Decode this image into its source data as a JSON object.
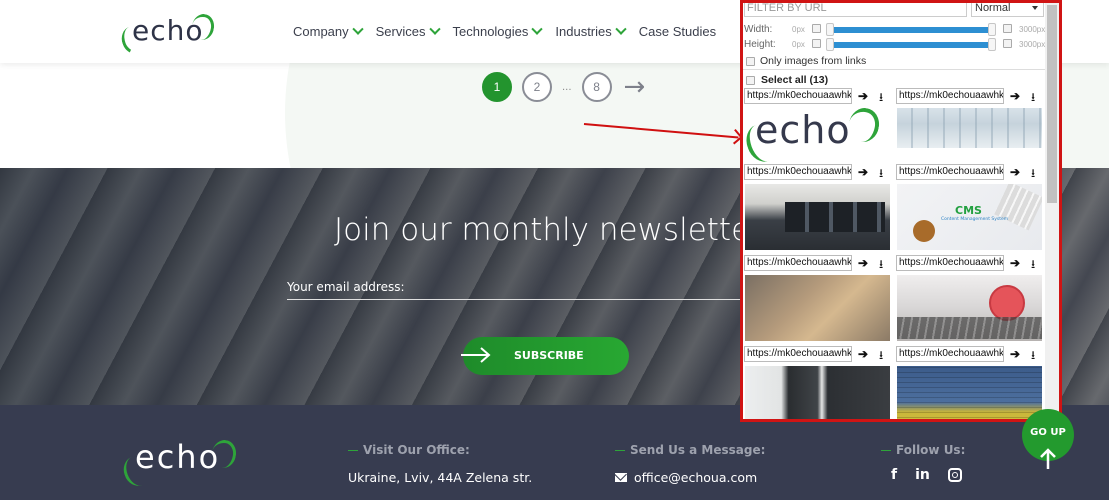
{
  "header": {
    "logo_text": "echo",
    "nav": [
      {
        "label": "Company",
        "has_dropdown": true
      },
      {
        "label": "Services",
        "has_dropdown": true
      },
      {
        "label": "Technologies",
        "has_dropdown": true
      },
      {
        "label": "Industries",
        "has_dropdown": true
      },
      {
        "label": "Case Studies",
        "has_dropdown": false
      }
    ]
  },
  "pagination": {
    "pages": [
      "1",
      "2",
      "8"
    ],
    "current": "1",
    "ellipsis": "...",
    "next_icon": "arrow-right-icon"
  },
  "newsletter": {
    "title": "Join our monthly newsletter",
    "email_placeholder": "Your email address:",
    "subscribe_label": "SUBSCRIBE"
  },
  "footer": {
    "logo_text": "echo",
    "office_heading": "Visit Our Office:",
    "office_address": "Ukraine, Lviv, 44A Zelena str.",
    "message_heading": "Send Us a Message:",
    "email": "office@echoua.com",
    "follow_heading": "Follow Us:",
    "social": [
      {
        "icon": "facebook-icon",
        "glyph": "f"
      },
      {
        "icon": "linkedin-icon",
        "glyph": "in"
      },
      {
        "icon": "instagram-icon",
        "glyph": ""
      }
    ],
    "go_up_label": "GO UP"
  },
  "extension": {
    "filter_placeholder": "FILTER BY URL",
    "mode_value": "Normal",
    "width_label": "Width:",
    "height_label": "Height:",
    "min_label": "0px",
    "max_label": "3000px",
    "width_range": [
      0,
      3000
    ],
    "height_range": [
      0,
      3000
    ],
    "only_links_label": "Only images from links",
    "select_all_label": "Select all (13)",
    "go_glyph": "➔",
    "download_glyph": "⭳",
    "images": [
      {
        "url": "https://mk0echouaawhk",
        "thumb": "echo-logo"
      },
      {
        "url": "https://mk0echouaawhk",
        "thumb": "building"
      },
      {
        "url": "https://mk0echouaawhk",
        "thumb": "office-workers"
      },
      {
        "url": "https://mk0echouaawhk",
        "thumb": "cms-diagram",
        "thumb_title": "CMS",
        "thumb_subtitle": "Content Management System"
      },
      {
        "url": "https://mk0echouaawhk",
        "thumb": "team-hands"
      },
      {
        "url": "https://mk0echouaawhk",
        "thumb": "alarm-clock"
      },
      {
        "url": "https://mk0echouaawhk",
        "thumb": "monitors"
      },
      {
        "url": "https://mk0echouaawhk",
        "thumb": "ukraine-flag-wall"
      }
    ]
  }
}
